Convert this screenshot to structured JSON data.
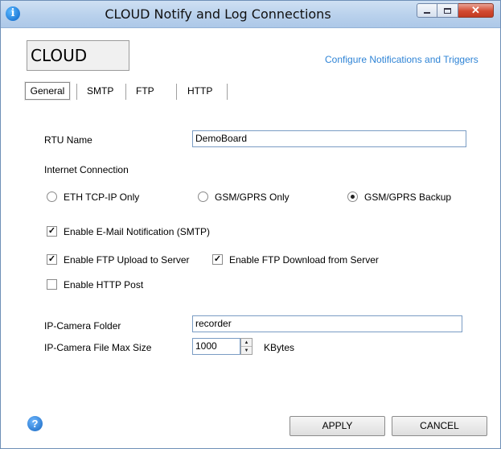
{
  "window": {
    "title": "CLOUD Notify and Log Connections",
    "icon": "info-icon"
  },
  "header": {
    "cloud_label": "CLOUD",
    "config_link": "Configure Notifications and Triggers"
  },
  "tabs": [
    {
      "label": "General",
      "active": true
    },
    {
      "label": "SMTP",
      "active": false
    },
    {
      "label": "FTP",
      "active": false
    },
    {
      "label": "HTTP",
      "active": false
    }
  ],
  "form": {
    "rtu_name_label": "RTU Name",
    "rtu_name_value": "DemoBoard",
    "internet_connection_label": "Internet Connection",
    "radios": [
      {
        "label": "ETH TCP-IP Only",
        "checked": false
      },
      {
        "label": "GSM/GPRS Only",
        "checked": false
      },
      {
        "label": "GSM/GPRS Backup",
        "checked": true
      }
    ],
    "checks": {
      "email": {
        "label": "Enable E-Mail Notification (SMTP)",
        "checked": true
      },
      "ftp_upload": {
        "label": "Enable FTP Upload to Server",
        "checked": true
      },
      "ftp_download": {
        "label": "Enable FTP Download from Server",
        "checked": true
      },
      "http_post": {
        "label": "Enable HTTP Post",
        "checked": false
      }
    },
    "camera_folder_label": "IP-Camera Folder",
    "camera_folder_value": "recorder",
    "camera_max_size_label": "IP-Camera File Max Size",
    "camera_max_size_value": "1000",
    "camera_max_size_unit": "KBytes"
  },
  "footer": {
    "apply_label": "APPLY",
    "cancel_label": "CANCEL"
  },
  "colors": {
    "link": "#2f84d6",
    "titlebar": "#b9d1ec",
    "close_button": "#d24a31"
  }
}
